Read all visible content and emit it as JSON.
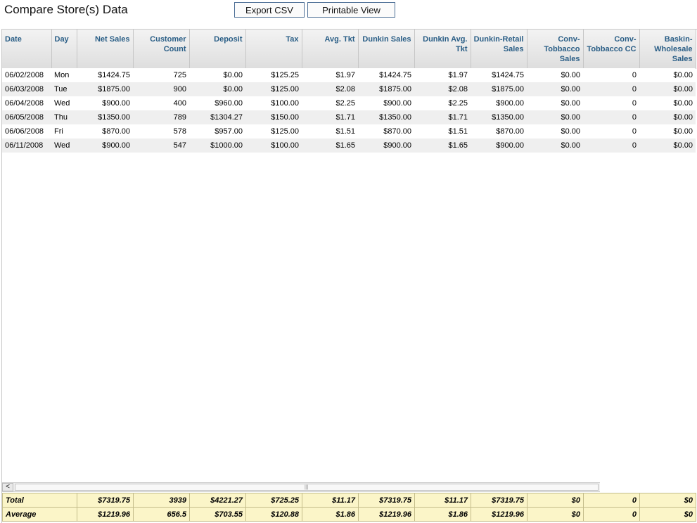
{
  "header": {
    "title": "Compare Store(s) Data",
    "export_label": "Export CSV",
    "print_label": "Printable View"
  },
  "columns": [
    "Date",
    "Day",
    "Net Sales",
    "Customer Count",
    "Deposit",
    "Tax",
    "Avg. Tkt",
    "Dunkin Sales",
    "Dunkin Avg. Tkt",
    "Dunkin-Retail Sales",
    "Conv-Tobbacco Sales",
    "Conv-Tobbacco CC",
    "Baskin-Wholesale Sales"
  ],
  "rows": [
    [
      "06/02/2008",
      "Mon",
      "$1424.75",
      "725",
      "$0.00",
      "$125.25",
      "$1.97",
      "$1424.75",
      "$1.97",
      "$1424.75",
      "$0.00",
      "0",
      "$0.00"
    ],
    [
      "06/03/2008",
      "Tue",
      "$1875.00",
      "900",
      "$0.00",
      "$125.00",
      "$2.08",
      "$1875.00",
      "$2.08",
      "$1875.00",
      "$0.00",
      "0",
      "$0.00"
    ],
    [
      "06/04/2008",
      "Wed",
      "$900.00",
      "400",
      "$960.00",
      "$100.00",
      "$2.25",
      "$900.00",
      "$2.25",
      "$900.00",
      "$0.00",
      "0",
      "$0.00"
    ],
    [
      "06/05/2008",
      "Thu",
      "$1350.00",
      "789",
      "$1304.27",
      "$150.00",
      "$1.71",
      "$1350.00",
      "$1.71",
      "$1350.00",
      "$0.00",
      "0",
      "$0.00"
    ],
    [
      "06/06/2008",
      "Fri",
      "$870.00",
      "578",
      "$957.00",
      "$125.00",
      "$1.51",
      "$870.00",
      "$1.51",
      "$870.00",
      "$0.00",
      "0",
      "$0.00"
    ],
    [
      "06/11/2008",
      "Wed",
      "$900.00",
      "547",
      "$1000.00",
      "$100.00",
      "$1.65",
      "$900.00",
      "$1.65",
      "$900.00",
      "$0.00",
      "0",
      "$0.00"
    ]
  ],
  "footer": [
    [
      "Total",
      "$7319.75",
      "3939",
      "$4221.27",
      "$725.25",
      "$11.17",
      "$7319.75",
      "$11.17",
      "$7319.75",
      "$0",
      "0",
      "$0"
    ],
    [
      "Average",
      "$1219.96",
      "656.5",
      "$703.55",
      "$120.88",
      "$1.86",
      "$1219.96",
      "$1.86",
      "$1219.96",
      "$0",
      "0",
      "$0"
    ]
  ],
  "scrollbar": {
    "left_arrow": "<",
    "grip": "|||"
  }
}
